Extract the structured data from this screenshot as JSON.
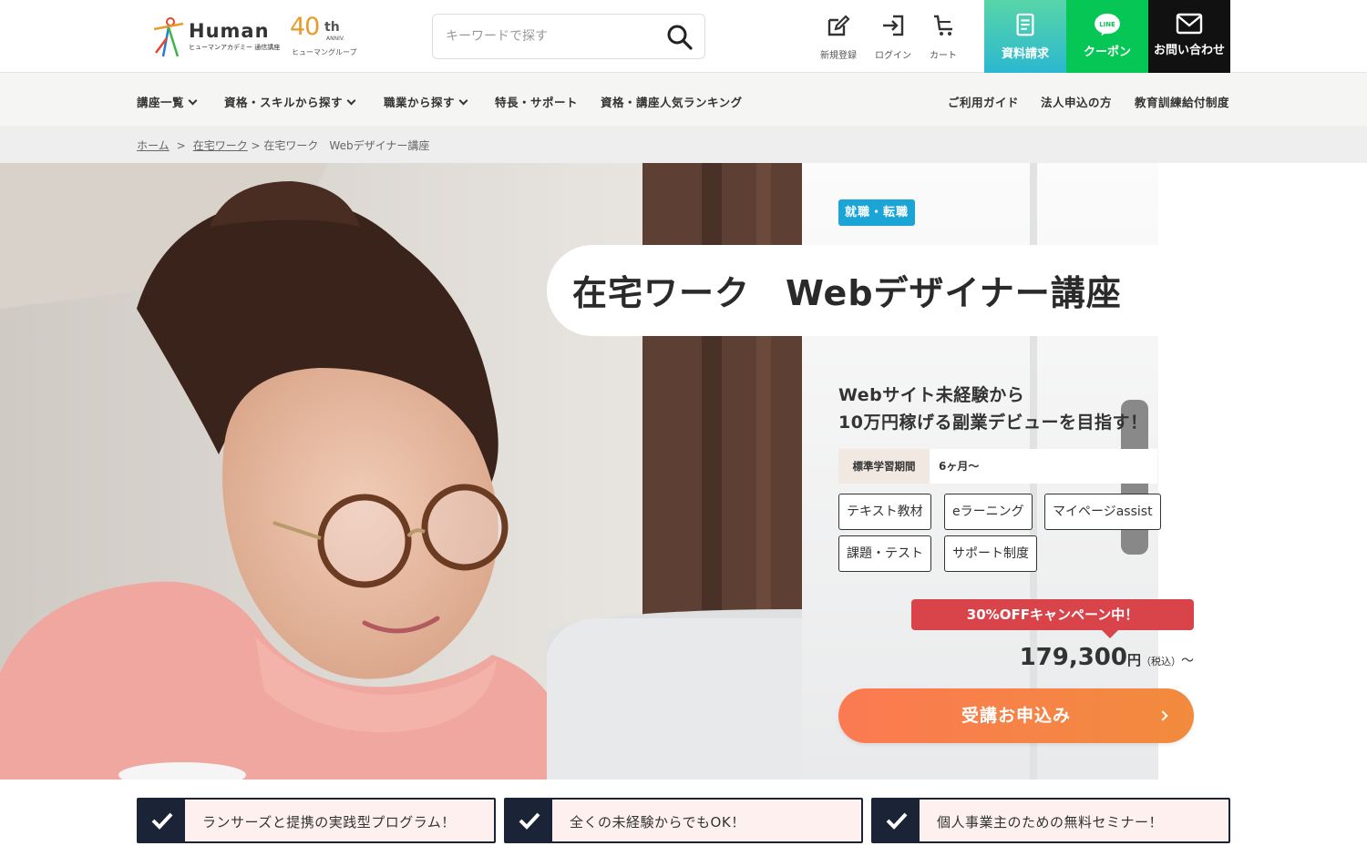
{
  "header": {
    "logo": {
      "word": "Human",
      "sub": "ヒューマンアカデミー 通信講座"
    },
    "anniversary": {
      "num": "40",
      "th": "th",
      "anniv": "ANNIV.",
      "group": "ヒューマングループ"
    },
    "search": {
      "placeholder": "キーワードで探す"
    },
    "icons": [
      {
        "label": "新規登録",
        "icon": "edit-icon"
      },
      {
        "label": "ログイン",
        "icon": "login-icon"
      },
      {
        "label": "カート",
        "icon": "cart-icon"
      }
    ],
    "buttons": [
      {
        "label": "資料請求",
        "icon": "document-icon",
        "color": "#3ec8c0"
      },
      {
        "label": "クーポン",
        "icon": "line-icon",
        "color": "#06c755"
      },
      {
        "label": "お問い合わせ",
        "icon": "mail-icon",
        "color": "#111111"
      }
    ]
  },
  "nav": {
    "left": [
      "講座一覧",
      "資格・スキルから探す",
      "職業から探す",
      "特長・サポート",
      "資格・講座人気ランキング"
    ],
    "right": [
      "ご利用ガイド",
      "法人申込の方",
      "教育訓練給付制度"
    ]
  },
  "breadcrumb": {
    "home": "ホーム",
    "sep1": ">",
    "category": "在宅ワーク",
    "current": "> 在宅ワーク　Webデザイナー講座"
  },
  "hero": {
    "tag": "就職・転職",
    "title": "在宅ワーク　Webデザイナー講座",
    "catch_line1": "Webサイト未経験から",
    "catch_line2": "10万円稼げる副業デビューを目指す！",
    "period_label": "標準学習期間",
    "period_value": "6ヶ月〜",
    "features": [
      "テキスト教材",
      "eラーニング",
      "マイページassist",
      "課題・テスト",
      "サポート制度"
    ],
    "campaign": "30%OFFキャンペーン中！",
    "price": "179,300",
    "price_yen": "円",
    "price_tax": "（税込）",
    "price_tilde": "～",
    "apply": "受講お申込み"
  },
  "points": [
    "ランサーズと提携の実践型プログラム！",
    "全くの未経験からでもOK！",
    "個人事業主のための無料セミナー！"
  ],
  "colors": {
    "tag": "#1aa5d6",
    "campaign": "#d9444b",
    "apply_start": "#fb7a52",
    "apply_end": "#f28b3d",
    "point_dark": "#1b2437",
    "point_bg": "#fdf0ef"
  }
}
